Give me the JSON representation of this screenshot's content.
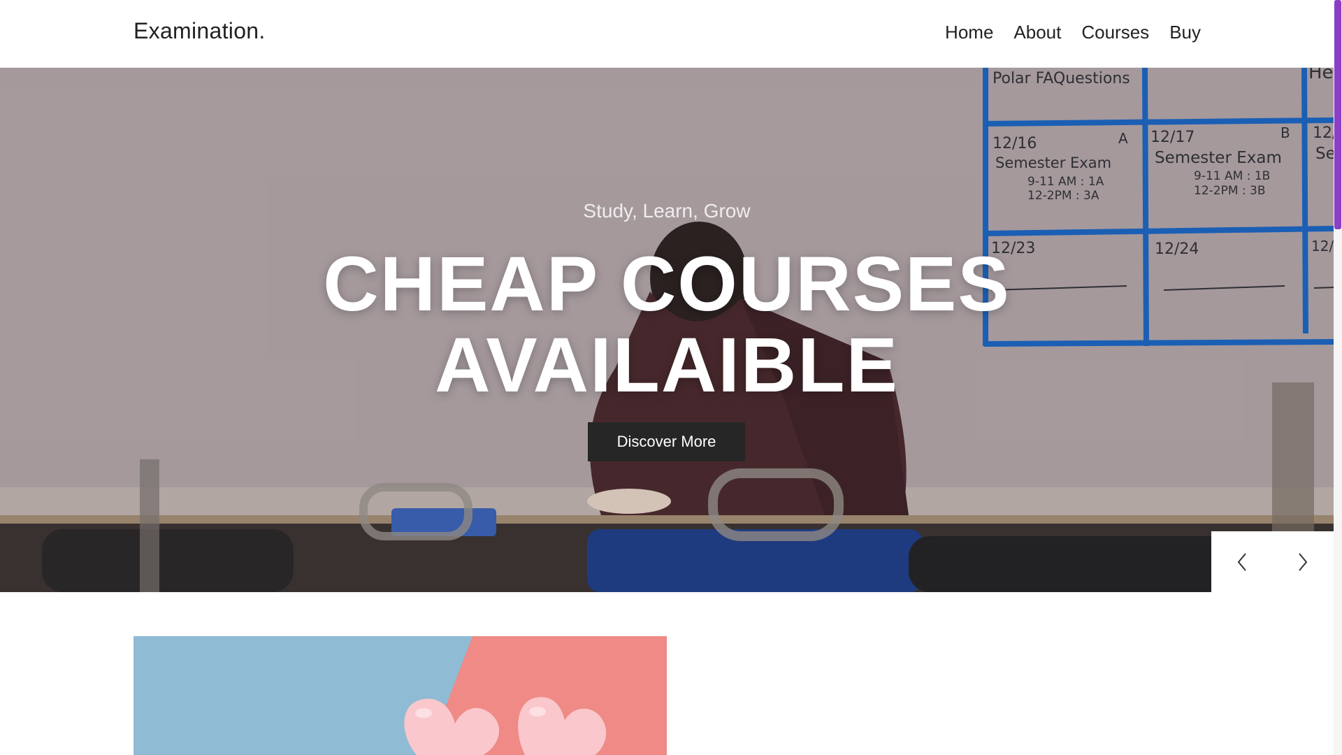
{
  "brand": {
    "name": "Examination."
  },
  "nav": {
    "items": [
      {
        "label": "Home"
      },
      {
        "label": "About"
      },
      {
        "label": "Courses"
      },
      {
        "label": "Buy"
      }
    ]
  },
  "hero": {
    "subtitle": "Study, Learn, Grow",
    "title_line1": "CHEAP COURSES",
    "title_line2": "AVAILAIBLE",
    "button_label": "Discover More",
    "whiteboard": {
      "header": "Polar FAQuestions",
      "cell1_date": "12/16",
      "cell1_letter": "A",
      "cell1_title": "Semester Exam",
      "cell1_line1": "9-11 AM : 1A",
      "cell1_line2": "12-2PM : 3A",
      "cell2_date": "12/17",
      "cell2_letter": "B",
      "cell2_title": "Semester Exam",
      "cell2_line1": "9-11 AM : 1B",
      "cell2_line2": "12-2PM : 3B",
      "cell3_date": "12/23",
      "cell4_date": "12/24",
      "edge_top": "He",
      "edge_mid1": "12/",
      "edge_mid2": "Se",
      "edge_low": "12/"
    }
  },
  "slider": {
    "prev_icon": "chevron-left-icon",
    "next_icon": "chevron-right-icon"
  },
  "colors": {
    "scroll_thumb": "#8b3fc6",
    "button_bg": "#262626",
    "card_left": "#8fbbd4",
    "card_right": "#ef8a86"
  }
}
